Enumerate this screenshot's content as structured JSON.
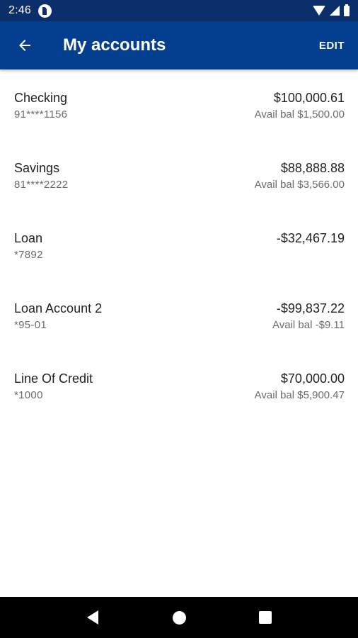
{
  "status_bar": {
    "time": "2:46"
  },
  "app_bar": {
    "title": "My accounts",
    "edit_label": "EDIT"
  },
  "accounts": [
    {
      "name": "Checking",
      "number": "91****1156",
      "balance": "$100,000.61",
      "available": "Avail bal $1,500.00"
    },
    {
      "name": "Savings",
      "number": "81****2222",
      "balance": "$88,888.88",
      "available": "Avail bal $3,566.00"
    },
    {
      "name": "Loan",
      "number": "*7892",
      "balance": "-$32,467.19",
      "available": ""
    },
    {
      "name": "Loan Account 2",
      "number": "*95-01",
      "balance": "-$99,837.22",
      "available": "Avail bal -$9.11"
    },
    {
      "name": "Line Of Credit",
      "number": "*1000",
      "balance": "$70,000.00",
      "available": "Avail bal $5,900.47"
    }
  ],
  "colors": {
    "app_bar": "#043f8f",
    "status_bar": "#0b2f6b",
    "nav_bar": "#000000"
  },
  "icons": {
    "back": "arrow-left-icon",
    "nav_back": "triangle-back-icon",
    "nav_home": "circle-home-icon",
    "nav_recents": "square-recents-icon"
  }
}
